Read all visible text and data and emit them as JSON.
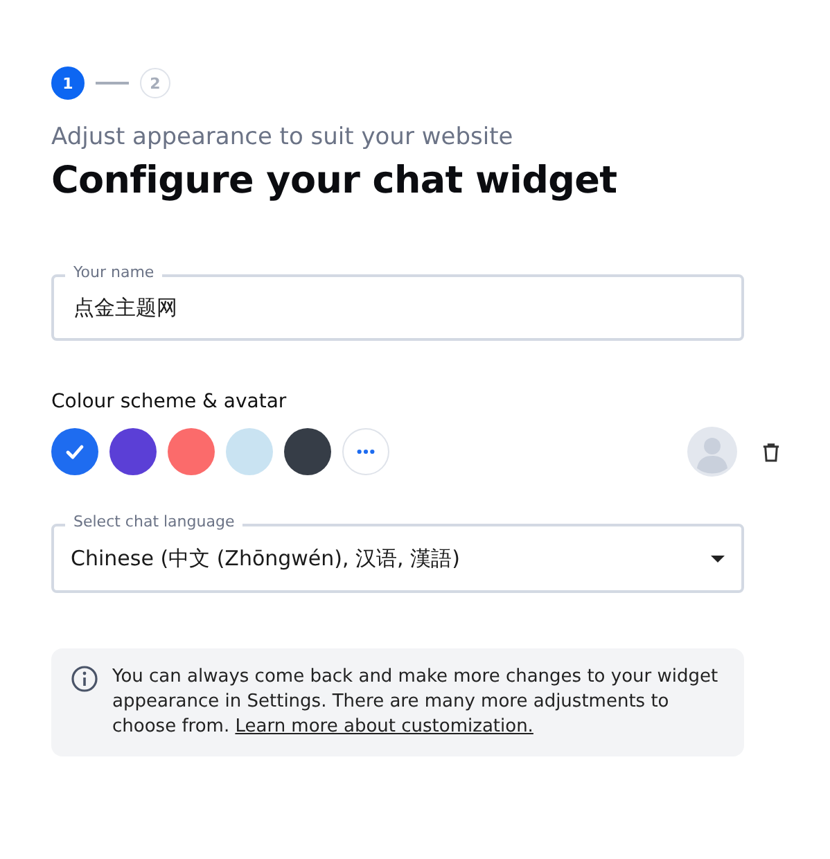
{
  "steps": [
    {
      "label": "1",
      "selected": true
    },
    {
      "label": "2",
      "selected": false
    }
  ],
  "subtitle": "Adjust appearance to suit your website",
  "title": "Configure your chat widget",
  "name_field": {
    "label": "Your name",
    "value": "点金主题网"
  },
  "colour_section": {
    "label": "Colour scheme & avatar",
    "swatches": [
      {
        "color": "#1e6cf0",
        "selected": true
      },
      {
        "color": "#5b3fd6",
        "selected": false
      },
      {
        "color": "#fb6b6b",
        "selected": false
      },
      {
        "color": "#c9e3f2",
        "selected": false
      },
      {
        "color": "#363d47",
        "selected": false
      }
    ]
  },
  "language_select": {
    "label": "Select chat language",
    "value": "Chinese (中文 (Zhōngwén), 汉语, 漢語)"
  },
  "info": {
    "text": "You can always come back and make more changes to your widget appearance in Settings. There are many more adjustments to choose from. ",
    "link": "Learn more about customization."
  }
}
